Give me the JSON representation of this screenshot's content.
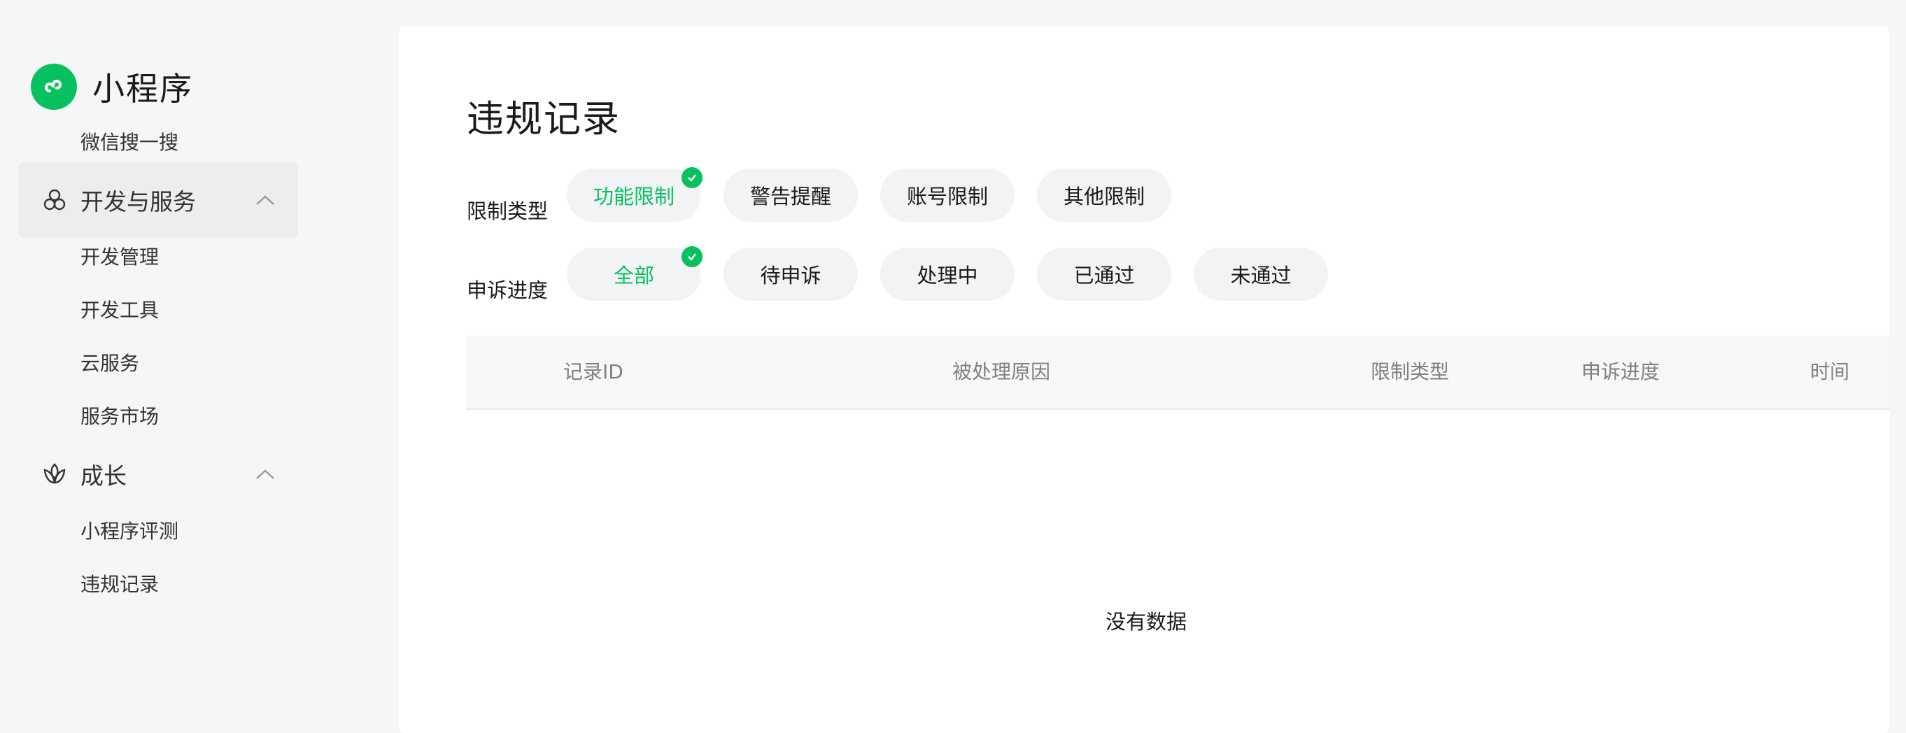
{
  "app": {
    "name": "小程序"
  },
  "sidebar": {
    "top_item": "微信搜一搜",
    "groups": [
      {
        "label": "开发与服务",
        "icon": "dev-services-icon",
        "items": [
          "开发管理",
          "开发工具",
          "云服务",
          "服务市场"
        ]
      },
      {
        "label": "成长",
        "icon": "growth-icon",
        "items": [
          "小程序评测",
          "违规记录"
        ]
      }
    ]
  },
  "page": {
    "title": "违规记录",
    "filters": [
      {
        "label": "限制类型",
        "options": [
          "功能限制",
          "警告提醒",
          "账号限制",
          "其他限制"
        ],
        "selected": "功能限制"
      },
      {
        "label": "申诉进度",
        "options": [
          "全部",
          "待申诉",
          "处理中",
          "已通过",
          "未通过"
        ],
        "selected": "全部"
      }
    ],
    "table": {
      "columns": [
        "记录ID",
        "被处理原因",
        "限制类型",
        "申诉进度",
        "时间"
      ],
      "empty_text": "没有数据"
    }
  },
  "colors": {
    "accent": "#07c160",
    "background": "#f5f6f7",
    "chip_bg": "#f2f3f5"
  }
}
